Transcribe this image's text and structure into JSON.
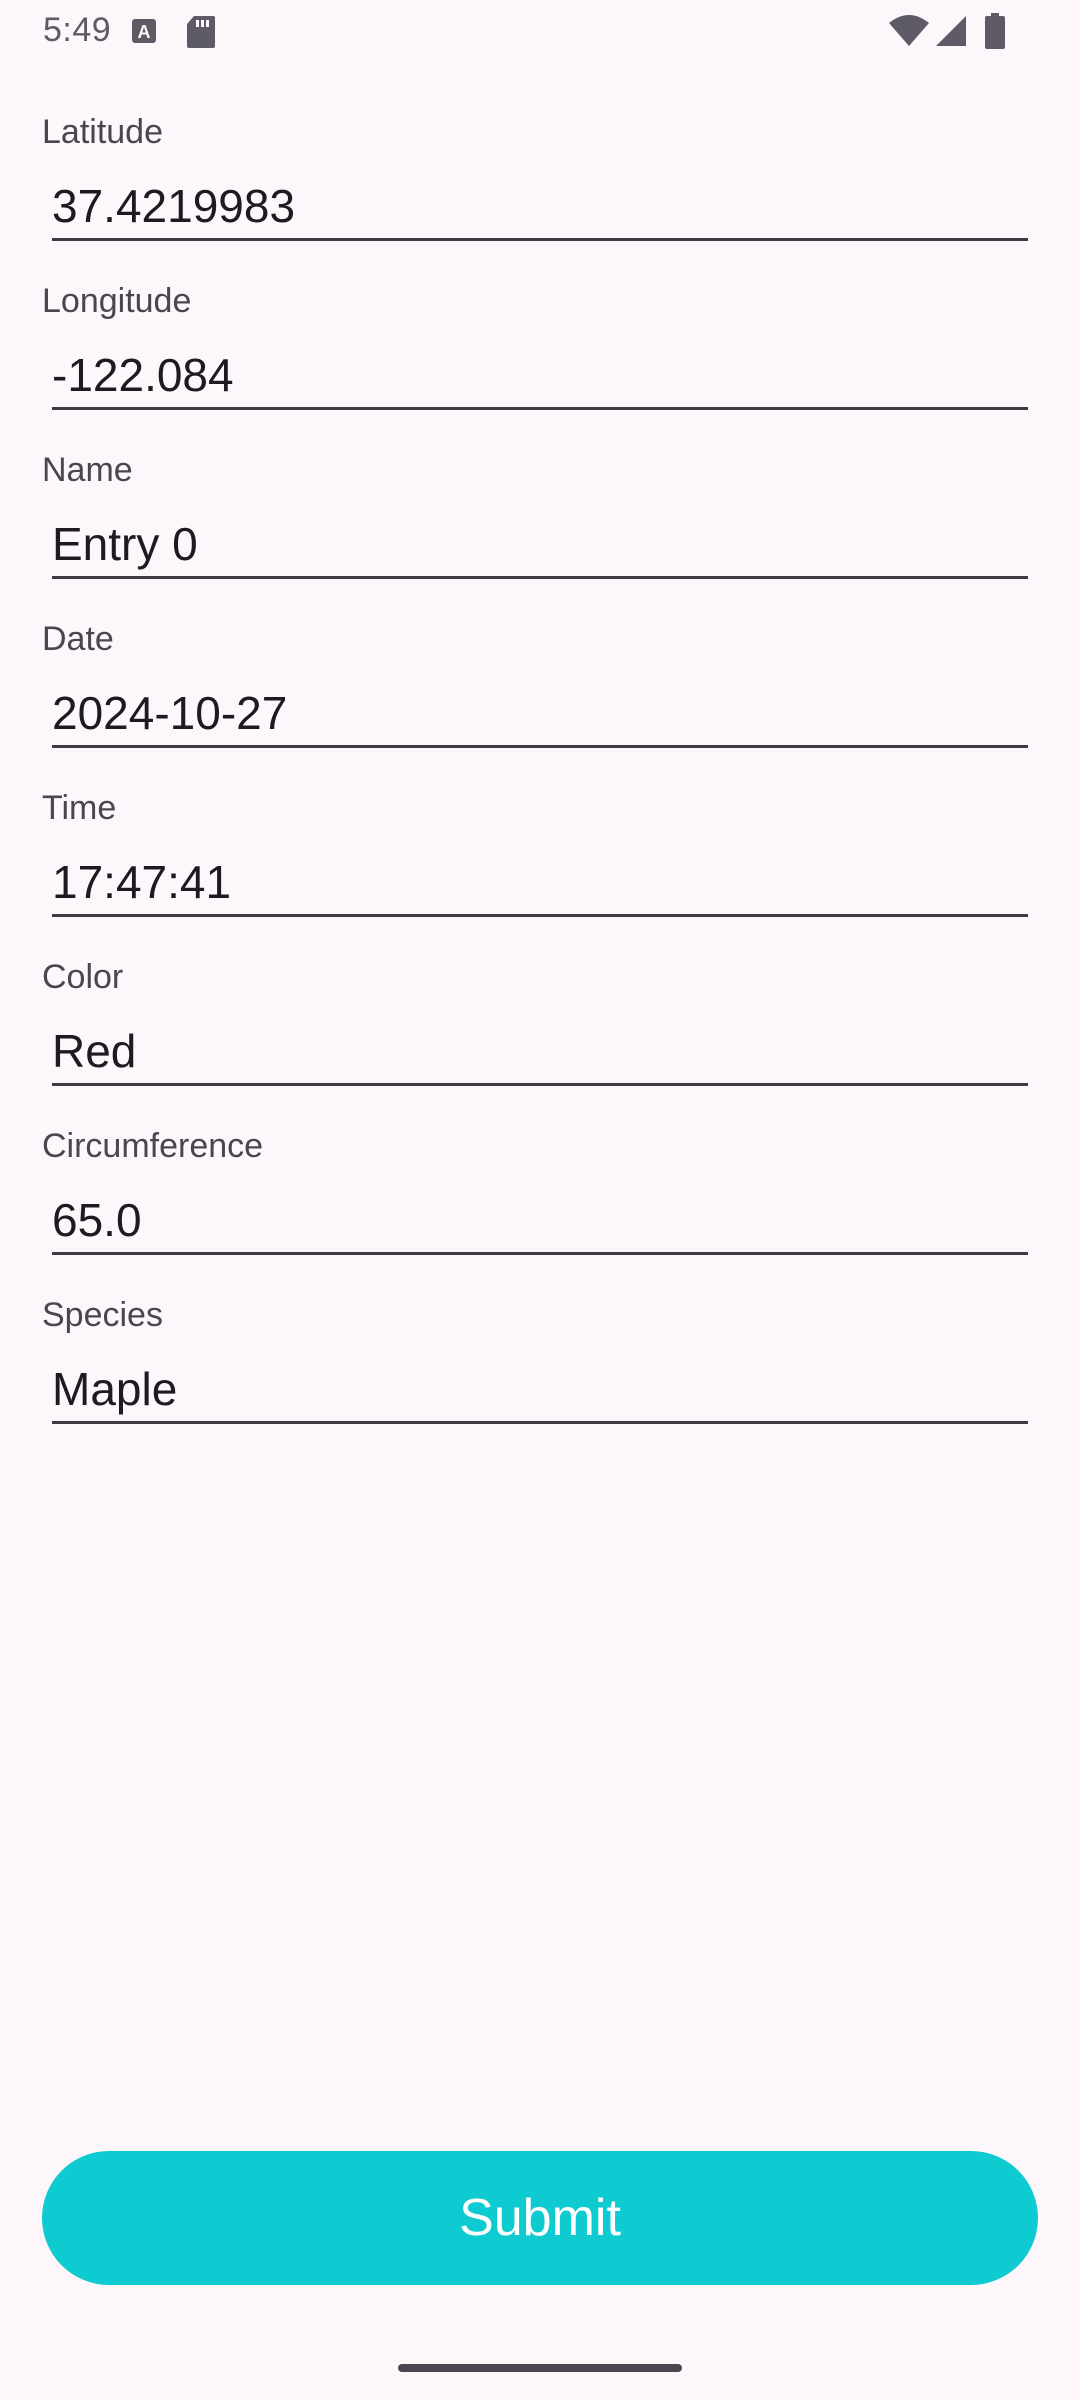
{
  "status_bar": {
    "time": "5:49",
    "icons": [
      "keyboard-a-icon",
      "sd-card-icon",
      "wifi-icon",
      "cell-signal-icon",
      "battery-icon"
    ]
  },
  "form": {
    "fields": [
      {
        "label": "Latitude",
        "value": "37.4219983"
      },
      {
        "label": "Longitude",
        "value": "-122.084"
      },
      {
        "label": "Name",
        "value": "Entry 0"
      },
      {
        "label": "Date",
        "value": "2024-10-27"
      },
      {
        "label": "Time",
        "value": "17:47:41"
      },
      {
        "label": "Color",
        "value": "Red"
      },
      {
        "label": "Circumference",
        "value": "65.0"
      },
      {
        "label": "Species",
        "value": "Maple"
      }
    ],
    "submit_label": "Submit"
  },
  "colors": {
    "background": "#fdf7fc",
    "accent": "#0ecbd1",
    "underline": "#3e3b43"
  }
}
